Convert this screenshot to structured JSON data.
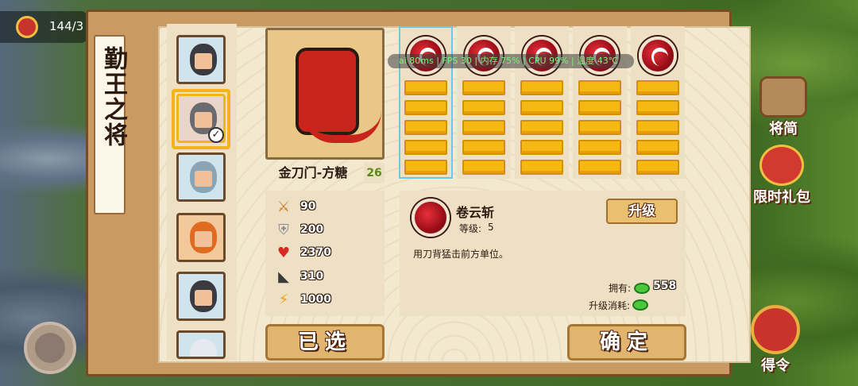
{
  "hud": {
    "resource_count": "144/3",
    "side_buttons": [
      {
        "label": "将简",
        "icon": "book-icon"
      },
      {
        "label": "限时礼包",
        "icon": "gift-pack-icon"
      },
      {
        "label": "得令",
        "icon": "command-seal-icon"
      }
    ]
  },
  "dialog": {
    "title": "勤王之将",
    "hero": {
      "name": "金刀门-方糖",
      "level": "26"
    },
    "stats": [
      {
        "icon": "sword-icon",
        "value": "90"
      },
      {
        "icon": "shield-icon",
        "value": "200"
      },
      {
        "icon": "heart-icon",
        "value": "2370"
      },
      {
        "icon": "boot-icon",
        "value": "310"
      },
      {
        "icon": "lightning-icon",
        "value": "1000"
      }
    ],
    "skill_columns": [
      {
        "icon": "slash-skill-icon",
        "active": true,
        "bars": 5
      },
      {
        "icon": "whirl-skill-icon",
        "active": false,
        "bars": 5
      },
      {
        "icon": "strike-skill-icon",
        "active": false,
        "bars": 5
      },
      {
        "icon": "fury-skill-icon",
        "active": false,
        "bars": 5
      },
      {
        "icon": "guard-skill-icon",
        "active": false,
        "bars": 5
      }
    ],
    "overlay_text": "ai 80ms | FPS 30 | 内存 75% | CPU 99% | 温度 43℃",
    "selected_skill": {
      "name": "卷云斩",
      "level_label": "等级:",
      "level_value": "5",
      "description": "用刀背猛击前方单位。",
      "upgrade_label": "升级",
      "owned_label": "拥有:",
      "owned_value": "558",
      "cost_label": "升级消耗:"
    },
    "selected_button": "已选",
    "confirm_button": "确定"
  }
}
